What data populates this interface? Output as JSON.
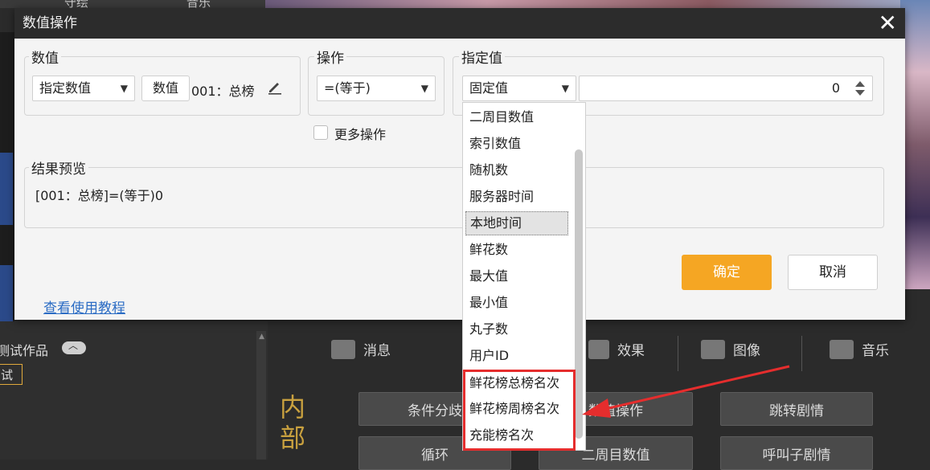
{
  "background": {
    "top_tabs": [
      "守绘",
      "音乐"
    ],
    "test_works_label": "测试作品",
    "try_tag": "试",
    "inner_label": "内部",
    "toolbar": [
      {
        "label": "消息",
        "icon": "message-icon"
      },
      {
        "label": "效果",
        "icon": "effects-icon"
      },
      {
        "label": "图像",
        "icon": "image-icon"
      },
      {
        "label": "音乐",
        "icon": "music-icon"
      }
    ],
    "buttons": [
      "条件分歧",
      "数值操作",
      "跳转剧情",
      "循环",
      "二周目数值",
      "呼叫子剧情"
    ]
  },
  "dialog": {
    "title": "数值操作",
    "value_group": {
      "legend": "数值",
      "type_select": "指定数值",
      "value_button": "数值",
      "value_text": "001：总榜"
    },
    "operation_group": {
      "legend": "操作",
      "select": "=(等于)"
    },
    "specified_group": {
      "legend": "指定值",
      "select": "固定值",
      "number": "0"
    },
    "more_ops_label": "更多操作",
    "preview": {
      "legend": "结果预览",
      "text": "[001：总榜]=(等于)0"
    },
    "ok_label": "确定",
    "cancel_label": "取消",
    "tutorial_link": "查看使用教程"
  },
  "dropdown": {
    "items": [
      "二周目数值",
      "索引数值",
      "随机数",
      "服务器时间",
      "本地时间",
      "鲜花数",
      "最大值",
      "最小值",
      "丸子数",
      "用户ID",
      "鲜花榜总榜名次",
      "鲜花榜周榜名次",
      "充能榜名次"
    ],
    "selected_index": 4
  },
  "colors": {
    "accent": "#f5a623",
    "highlight": "#e52d2d",
    "link": "#2b6cc4",
    "title_bar": "#2c2c2c"
  }
}
